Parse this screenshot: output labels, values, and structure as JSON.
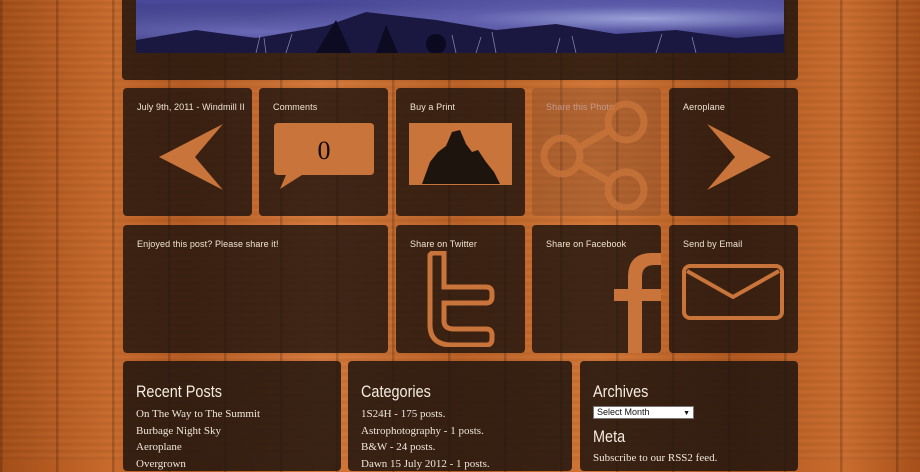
{
  "colors": {
    "wood": "#c0652a",
    "tile": "#1e140e",
    "icon": "#c9743a"
  },
  "nav_tiles": [
    {
      "label": "July 9th, 2011 - Windmill II",
      "icon": "arrow-left-icon"
    },
    {
      "label": "Comments",
      "count": "0",
      "icon": "comment-bubble-icon"
    },
    {
      "label": "Buy a Print",
      "icon": "print-icon"
    },
    {
      "label": "Share this Photo",
      "icon": "share-icon"
    },
    {
      "label": "Aeroplane",
      "icon": "arrow-right-icon"
    }
  ],
  "share_tiles": [
    {
      "label": "Enjoyed this post? Please share it!"
    },
    {
      "label": "Share on Twitter",
      "icon": "twitter-icon"
    },
    {
      "label": "Share on Facebook",
      "icon": "facebook-icon"
    },
    {
      "label": "Send by Email",
      "icon": "envelope-icon"
    }
  ],
  "recent_posts": {
    "title": "Recent Posts",
    "items": [
      "On The Way to The Summit",
      "Burbage Night Sky",
      "Aeroplane",
      "Overgrown"
    ]
  },
  "categories": {
    "title": "Categories",
    "items": [
      "1S24H - 175 posts.",
      "Astrophotography - 1 posts.",
      "B&W - 24 posts.",
      "Dawn 15 July 2012 - 1 posts."
    ]
  },
  "archives": {
    "title": "Archives",
    "select_value": "Select Month"
  },
  "meta": {
    "title": "Meta",
    "items": [
      "Subscribe to our RSS2 feed."
    ]
  }
}
